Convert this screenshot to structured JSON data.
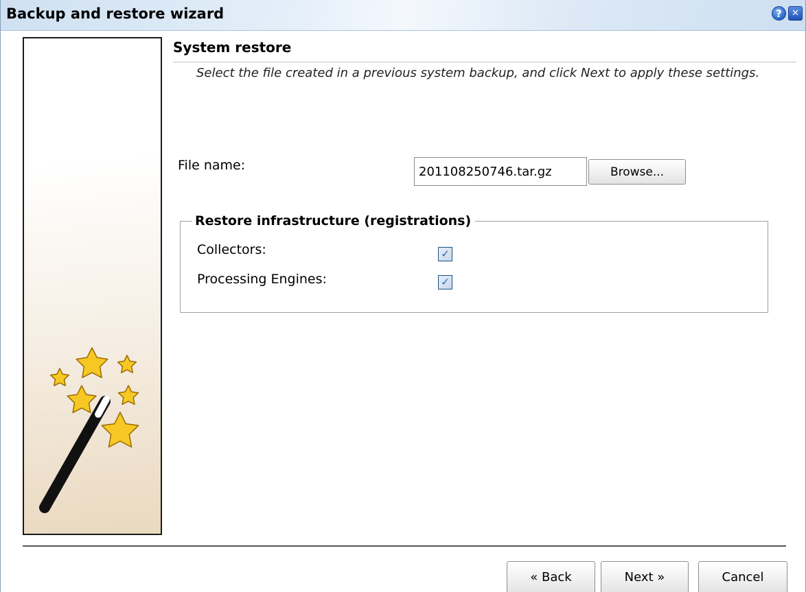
{
  "window": {
    "title": "Backup and restore wizard",
    "help_icon": "help-icon",
    "close_icon": "close-icon",
    "help_glyph": "?",
    "close_glyph": "✕"
  },
  "side_panel": {
    "illustration": "magic-wand-stars-icon"
  },
  "section": {
    "title": "System restore",
    "description": "Select the file created in a previous system backup, and click Next to apply these settings."
  },
  "file": {
    "label": "File name:",
    "value": "201108250746.tar.gz",
    "browse_label": "Browse..."
  },
  "restore_group": {
    "legend": "Restore infrastructure (registrations)",
    "options": [
      {
        "label": "Collectors:",
        "checked": true,
        "mark": "✓"
      },
      {
        "label": "Processing Engines:",
        "checked": true,
        "mark": "✓"
      }
    ]
  },
  "buttons": {
    "back": "« Back",
    "next": "Next »",
    "cancel": "Cancel"
  },
  "colors": {
    "titlebar": "#d6e5f5",
    "star_fill": "#f7c824",
    "star_stroke": "#9a6b00",
    "checkbox_mark": "#2c64b8"
  }
}
